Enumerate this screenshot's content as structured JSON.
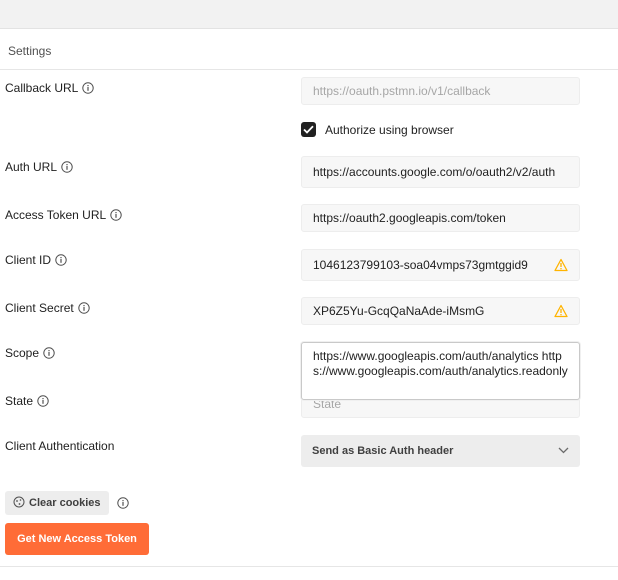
{
  "section": {
    "title": "Settings"
  },
  "fields": {
    "callback_url": {
      "label": "Callback URL",
      "placeholder": "https://oauth.pstmn.io/v1/callback"
    },
    "authorize_browser": {
      "label": "Authorize using browser",
      "checked": true
    },
    "auth_url": {
      "label": "Auth URL",
      "value": "https://accounts.google.com/o/oauth2/v2/auth"
    },
    "access_token_url": {
      "label": "Access Token URL",
      "value": "https://oauth2.googleapis.com/token"
    },
    "client_id": {
      "label": "Client ID",
      "value": "1046123799103-soa04vmps73gmtggid9"
    },
    "client_secret": {
      "label": "Client Secret",
      "value": "XP6Z5Yu-GcqQaNaAde-iMsmG"
    },
    "scope": {
      "label": "Scope",
      "value": "https://www.googleapis.com/auth/analytics https://www.googleapis.com/auth/analytics.readonly"
    },
    "state": {
      "label": "State",
      "placeholder": "State"
    },
    "client_authentication": {
      "label": "Client Authentication",
      "value": "Send as Basic Auth header"
    }
  },
  "buttons": {
    "clear_cookies": "Clear cookies",
    "get_token": "Get New Access Token"
  },
  "colors": {
    "accent": "#ff6c37",
    "warning": "#ffb400"
  },
  "icons": {
    "info": "info-icon",
    "warning": "warning-icon",
    "cookie": "cookie-icon",
    "chevron": "chevron-down-icon"
  }
}
